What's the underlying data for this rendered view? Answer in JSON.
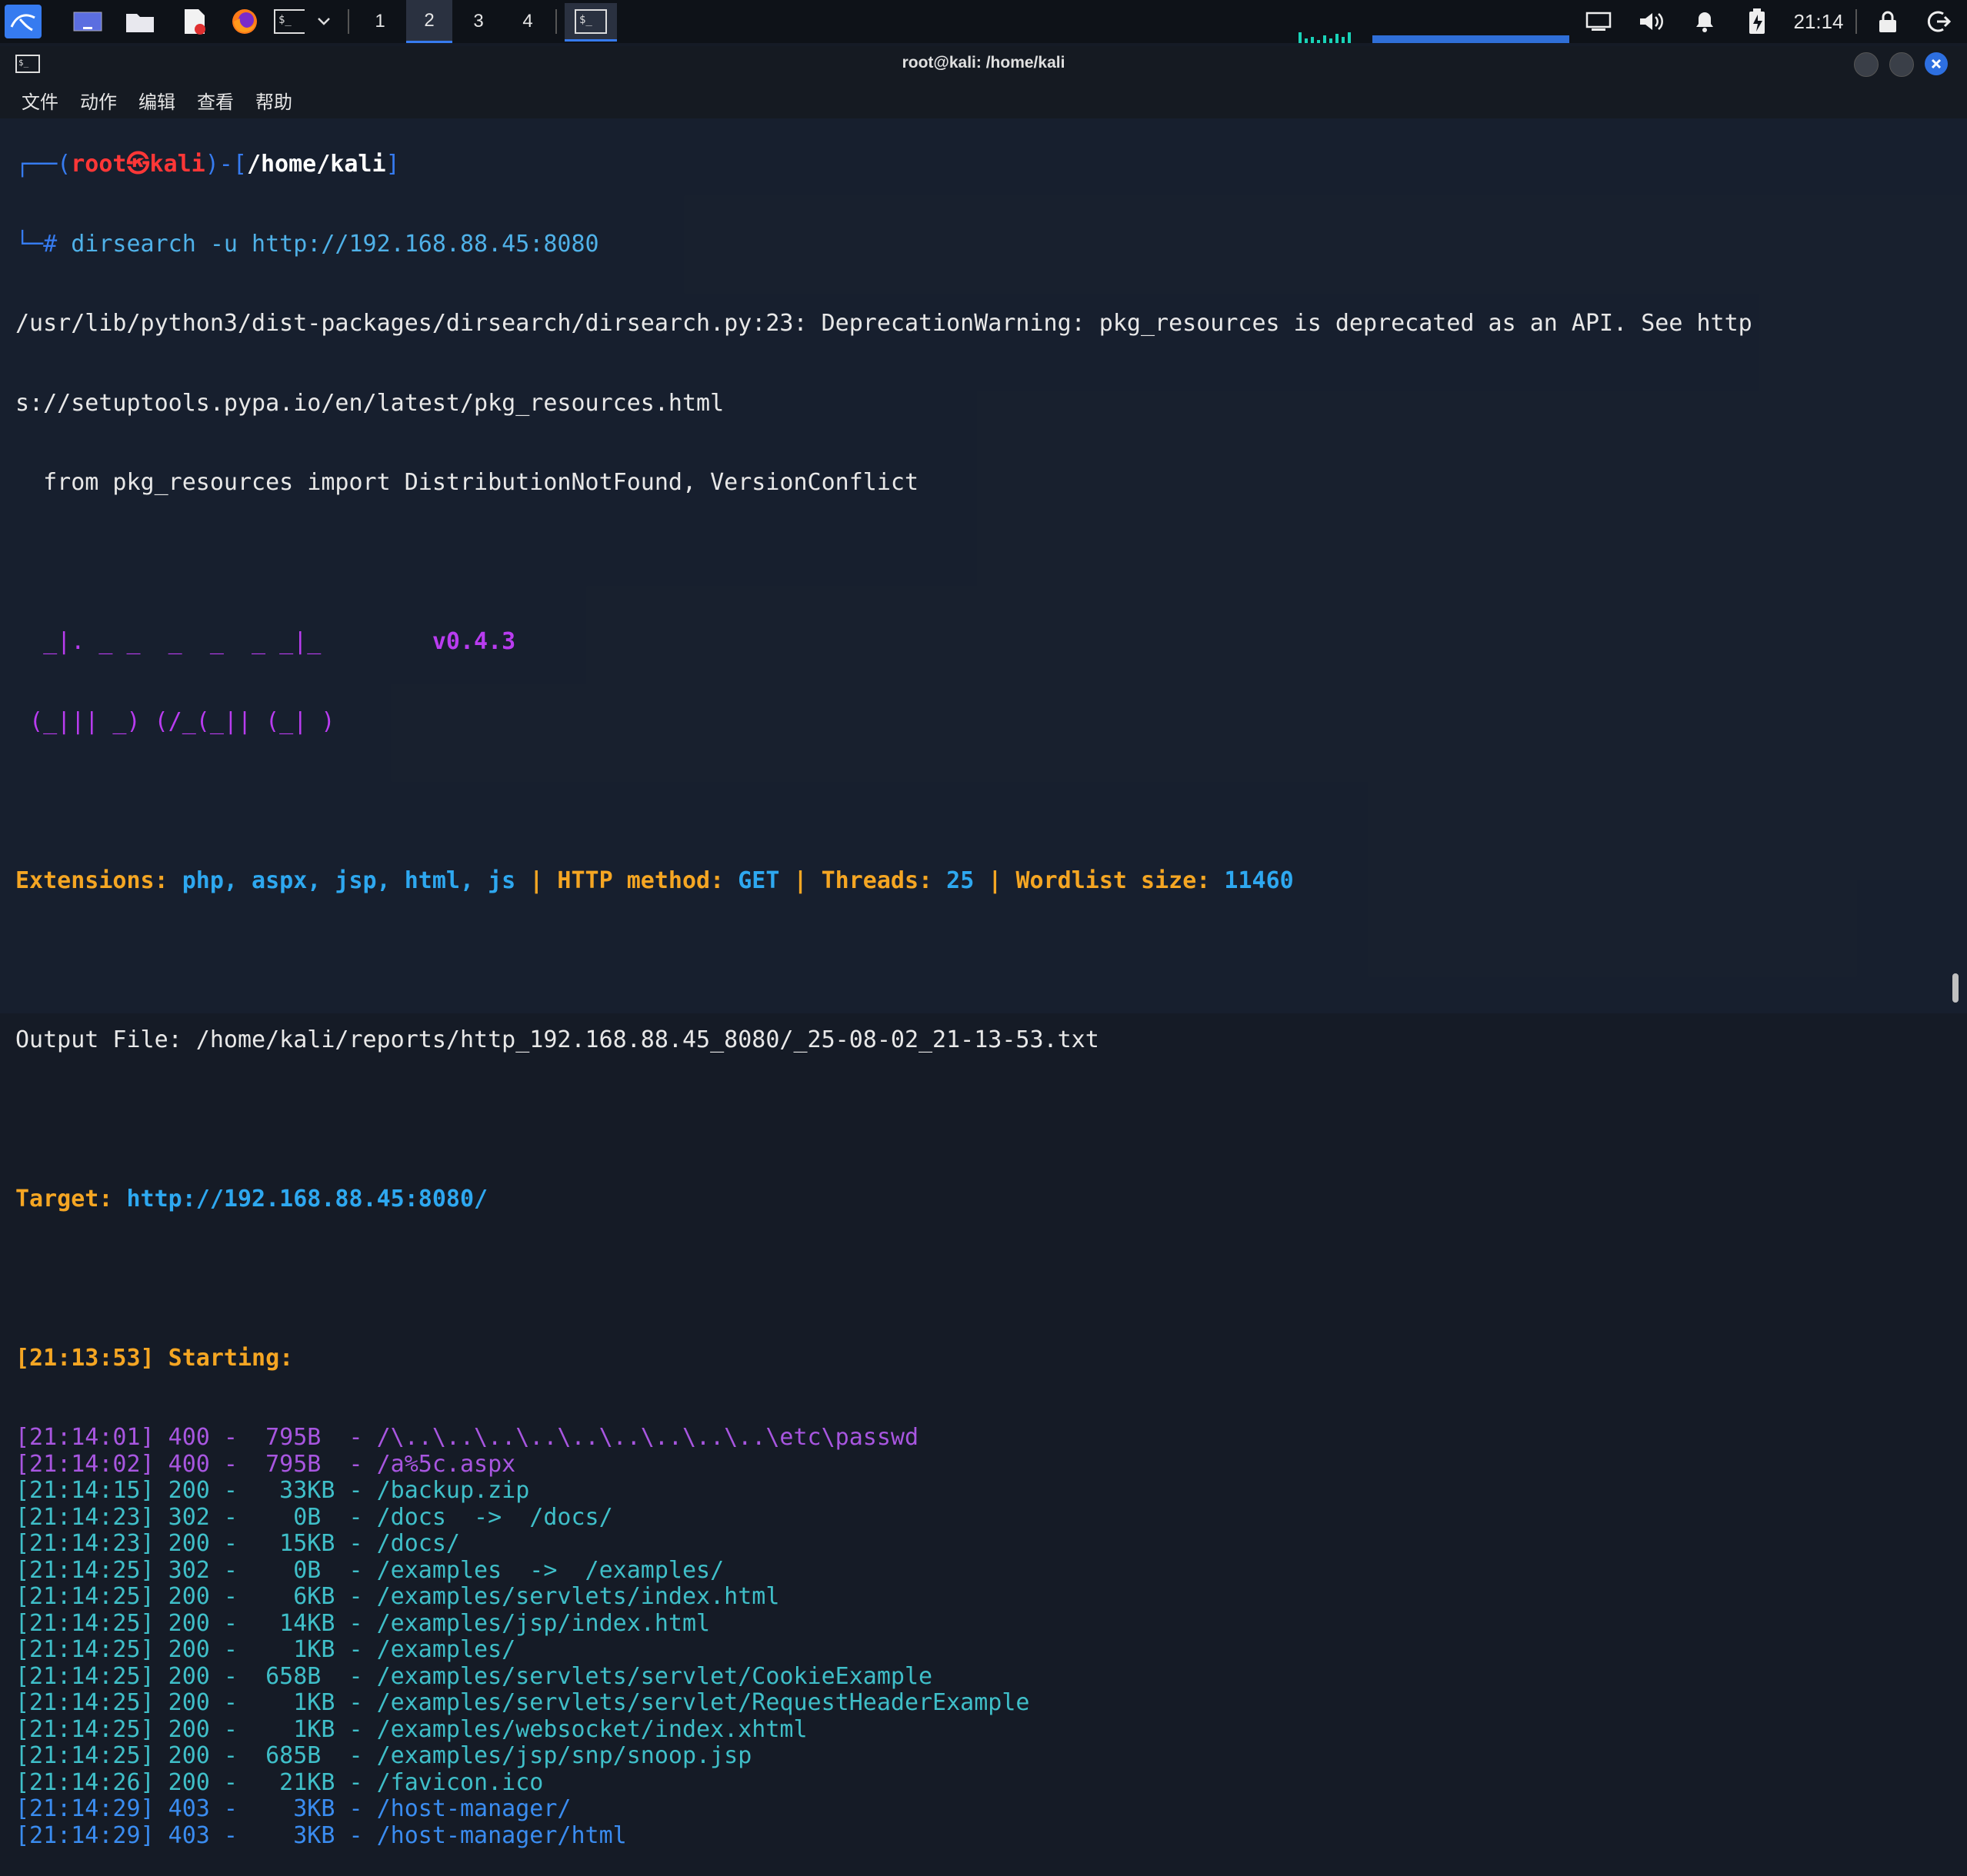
{
  "taskbar": {
    "workspaces": [
      "1",
      "2",
      "3",
      "4"
    ],
    "active_workspace": "2",
    "clock": "21:14"
  },
  "window": {
    "title": "root@kali: /home/kali",
    "menu": [
      "文件",
      "动作",
      "编辑",
      "查看",
      "帮助"
    ]
  },
  "terminal": {
    "prompt_open": "┌──(",
    "prompt_user": "root㉿kali",
    "prompt_mid": ")-[",
    "prompt_path": "/home/kali",
    "prompt_close": "]",
    "prompt_hash": "└─#",
    "command": "dirsearch -u http://192.168.88.45:8080",
    "warning_line1": "/usr/lib/python3/dist-packages/dirsearch/dirsearch.py:23: DeprecationWarning: pkg_resources is deprecated as an API. See http",
    "warning_line2": "s://setuptools.pypa.io/en/latest/pkg_resources.html",
    "warning_line3": "  from pkg_resources import DistributionNotFound, VersionConflict",
    "banner_line1": "  _|. _ _  _  _  _ _|_",
    "banner_line2": " (_||| _) (/_(_|| (_| )",
    "version": "v0.4.3",
    "extensions_label": "Extensions:",
    "extensions_value": "php, aspx, jsp, html, js",
    "pipe": "|",
    "method_label": "HTTP method:",
    "method_value": "GET",
    "threads_label": "Threads:",
    "threads_value": "25",
    "wordlist_label": "Wordlist size:",
    "wordlist_value": "11460",
    "output_file": "Output File: /home/kali/reports/http_192.168.88.45_8080/_25-08-02_21-13-53.txt",
    "target_label": "Target:",
    "target_value": "http://192.168.88.45:8080/",
    "starting": "[21:13:53] Starting:",
    "results": [
      {
        "text": "[21:14:01] 400 -  795B  - /\\..\\..\\..\\..\\..\\..\\..\\..\\..\\etc\\passwd",
        "status": "400"
      },
      {
        "text": "[21:14:02] 400 -  795B  - /a%5c.aspx",
        "status": "400"
      },
      {
        "text": "[21:14:15] 200 -   33KB - /backup.zip",
        "status": "200"
      },
      {
        "text": "[21:14:23] 302 -    0B  - /docs  ->  /docs/",
        "status": "302"
      },
      {
        "text": "[21:14:23] 200 -   15KB - /docs/",
        "status": "200"
      },
      {
        "text": "[21:14:25] 302 -    0B  - /examples  ->  /examples/",
        "status": "302"
      },
      {
        "text": "[21:14:25] 200 -    6KB - /examples/servlets/index.html",
        "status": "200"
      },
      {
        "text": "[21:14:25] 200 -   14KB - /examples/jsp/index.html",
        "status": "200"
      },
      {
        "text": "[21:14:25] 200 -    1KB - /examples/",
        "status": "200"
      },
      {
        "text": "[21:14:25] 200 -  658B  - /examples/servlets/servlet/CookieExample",
        "status": "200"
      },
      {
        "text": "[21:14:25] 200 -    1KB - /examples/servlets/servlet/RequestHeaderExample",
        "status": "200"
      },
      {
        "text": "[21:14:25] 200 -    1KB - /examples/websocket/index.xhtml",
        "status": "200"
      },
      {
        "text": "[21:14:25] 200 -  685B  - /examples/jsp/snp/snoop.jsp",
        "status": "200"
      },
      {
        "text": "[21:14:26] 200 -   21KB - /favicon.ico",
        "status": "200"
      },
      {
        "text": "[21:14:29] 403 -    3KB - /host-manager/",
        "status": "403"
      },
      {
        "text": "[21:14:29] 403 -    3KB - /host-manager/html",
        "status": "403"
      }
    ]
  },
  "colors": {
    "accent": "#367bf0",
    "prompt_red": "#ff3737",
    "orange": "#f5a623",
    "status_200": "#3fbfc9",
    "status_400": "#a856e0",
    "status_403": "#3a8cf0"
  }
}
